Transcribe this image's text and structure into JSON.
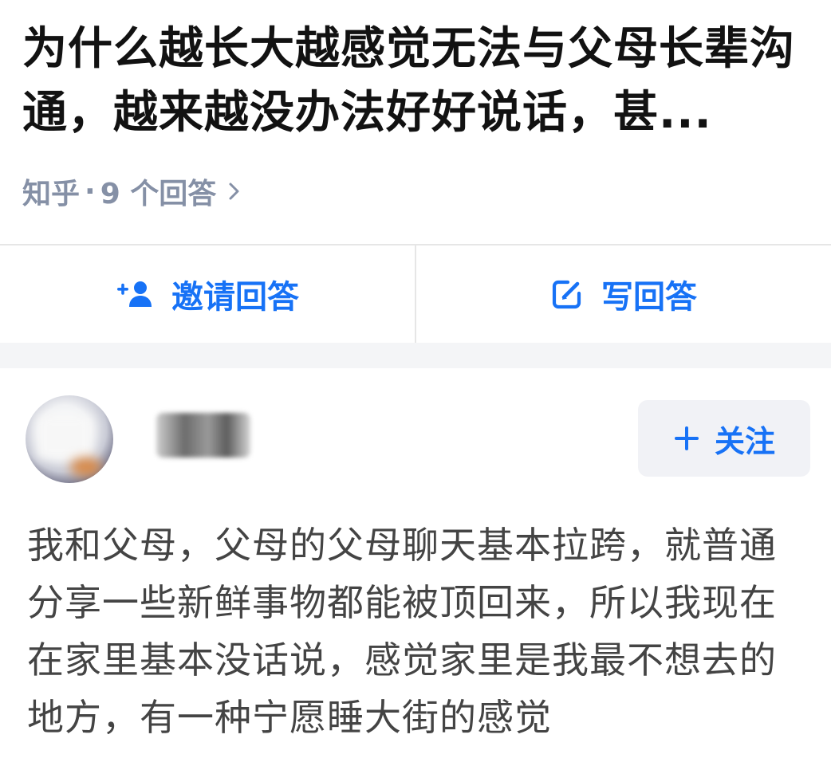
{
  "question": {
    "title": "为什么越长大越感觉无法与父母长辈沟通，越来越没办法好好说话，甚...",
    "source": "知乎",
    "separator": "·",
    "answer_count": "9 个回答",
    "chevron_icon": "chevron-right-icon"
  },
  "actions": {
    "invite_label": "邀请回答",
    "invite_icon": "add-person-icon",
    "write_label": "写回答",
    "write_icon": "edit-icon"
  },
  "answer": {
    "author_name": "",
    "follow_label": "关注",
    "follow_icon": "plus-icon",
    "body": "我和父母，父母的父母聊天基本拉跨，就普通分享一些新鲜事物都能被顶回来，所以我现在在家里基本没话说，感觉家里是我最不想去的地方，有一种宁愿睡大街的感觉"
  },
  "colors": {
    "accent": "#1772f6",
    "meta_text": "#8590a6",
    "body_text": "#444444",
    "divider": "#e6e6e6",
    "band": "#f4f5f7",
    "follow_bg": "#f1f2f6"
  }
}
